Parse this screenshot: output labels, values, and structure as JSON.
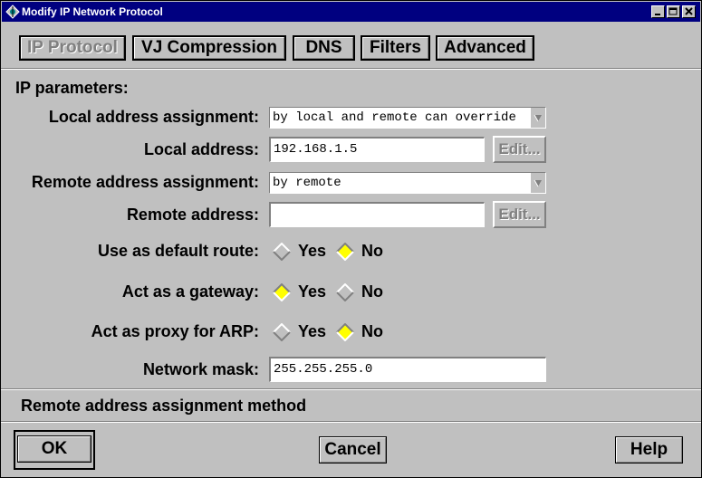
{
  "window": {
    "title": "Modify IP Network Protocol"
  },
  "tabs": [
    {
      "label": "IP Protocol",
      "active": true
    },
    {
      "label": "VJ Compression",
      "active": false
    },
    {
      "label": "DNS",
      "active": false
    },
    {
      "label": "Filters",
      "active": false
    },
    {
      "label": "Advanced",
      "active": false
    }
  ],
  "section": {
    "heading": "IP parameters:"
  },
  "form": {
    "local_assignment": {
      "label": "Local address assignment:",
      "value": "by local and remote can override"
    },
    "local_address": {
      "label": "Local address:",
      "value": "192.168.1.5",
      "edit_label": "Edit..."
    },
    "remote_assignment": {
      "label": "Remote address assignment:",
      "value": "by remote"
    },
    "remote_address": {
      "label": "Remote address:",
      "value": "",
      "edit_label": "Edit..."
    },
    "default_route": {
      "label": "Use as default route:",
      "yes": "Yes",
      "no": "No",
      "selected": "No"
    },
    "gateway": {
      "label": "Act as a gateway:",
      "yes": "Yes",
      "no": "No",
      "selected": "Yes"
    },
    "proxy_arp": {
      "label": "Act as proxy for ARP:",
      "yes": "Yes",
      "no": "No",
      "selected": "No"
    },
    "network_mask": {
      "label": "Network mask:",
      "value": "255.255.255.0"
    }
  },
  "status": {
    "text": "Remote address assignment method"
  },
  "buttons": {
    "ok": "OK",
    "cancel": "Cancel",
    "help": "Help"
  },
  "colors": {
    "titlebar": "#000080",
    "face": "#c0c0c0",
    "radio_selected": "#ffff00"
  }
}
